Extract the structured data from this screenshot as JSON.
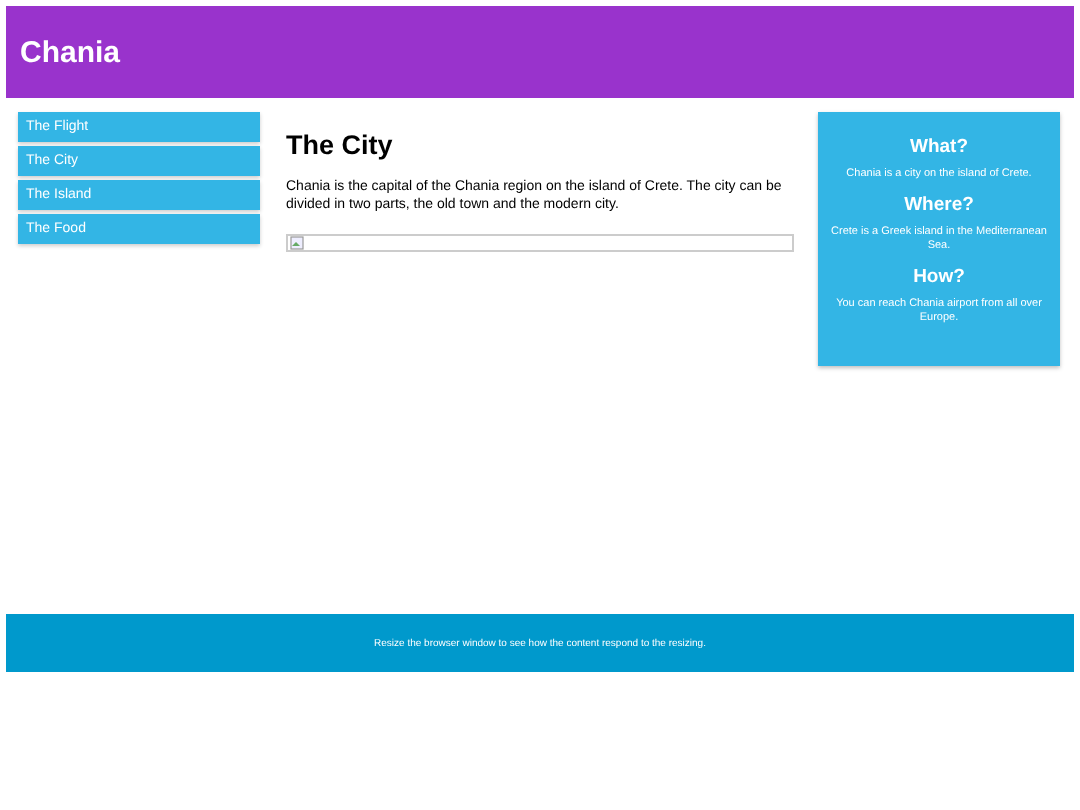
{
  "header": {
    "title": "Chania"
  },
  "menu": {
    "items": [
      {
        "label": "The Flight"
      },
      {
        "label": "The City"
      },
      {
        "label": "The Island"
      },
      {
        "label": "The Food"
      }
    ]
  },
  "main": {
    "heading": "The City",
    "paragraph": "Chania is the capital of the Chania region on the island of Crete. The city can be divided in two parts, the old town and the modern city.",
    "image": {
      "kind": "broken-image"
    }
  },
  "aside": {
    "sections": [
      {
        "heading": "What?",
        "text": "Chania is a city on the island of Crete."
      },
      {
        "heading": "Where?",
        "text": "Crete is a Greek island in the Mediterranean Sea."
      },
      {
        "heading": "How?",
        "text": "You can reach Chania airport from all over Europe."
      }
    ]
  },
  "footer": {
    "text": "Resize the browser window to see how the content respond to the resizing."
  }
}
